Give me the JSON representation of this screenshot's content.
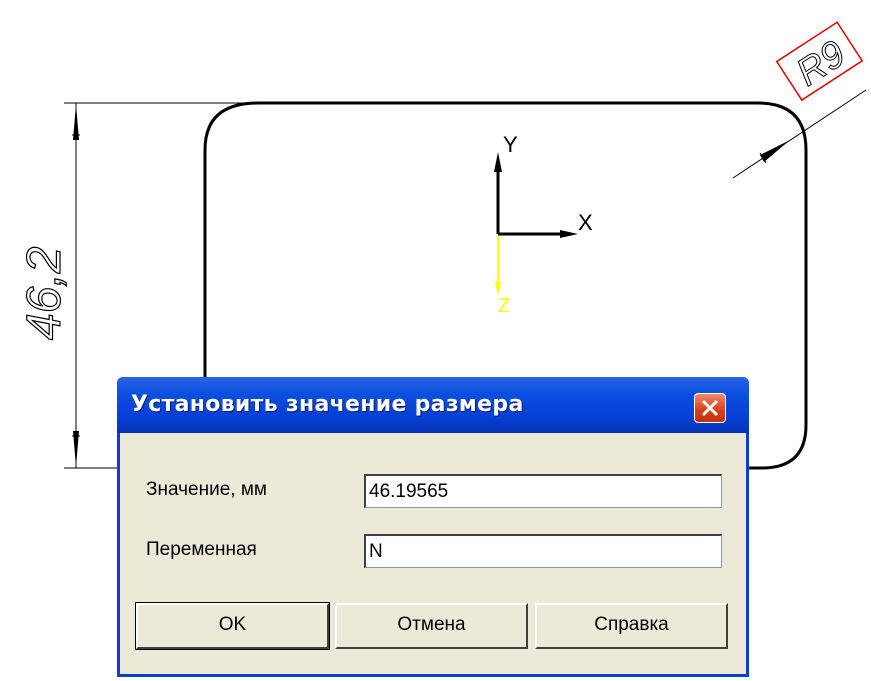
{
  "drawing": {
    "dimension_vertical": "46,2",
    "dimension_radius": "R9",
    "axis_x": "X",
    "axis_y": "Y",
    "axis_z": "Z"
  },
  "dialog": {
    "title": "Установить значение размера",
    "value_label": "Значение, мм",
    "value": "46.19565",
    "variable_label": "Переменная",
    "variable": "N",
    "ok_label": "OK",
    "cancel_label": "Отмена",
    "help_label": "Справка"
  },
  "colors": {
    "titlebar": "#0a4fe0",
    "close_button": "#d4401a",
    "dialog_background": "#ece9d8",
    "z_axis": "#ffff00",
    "radius_frame": "#e00000"
  }
}
